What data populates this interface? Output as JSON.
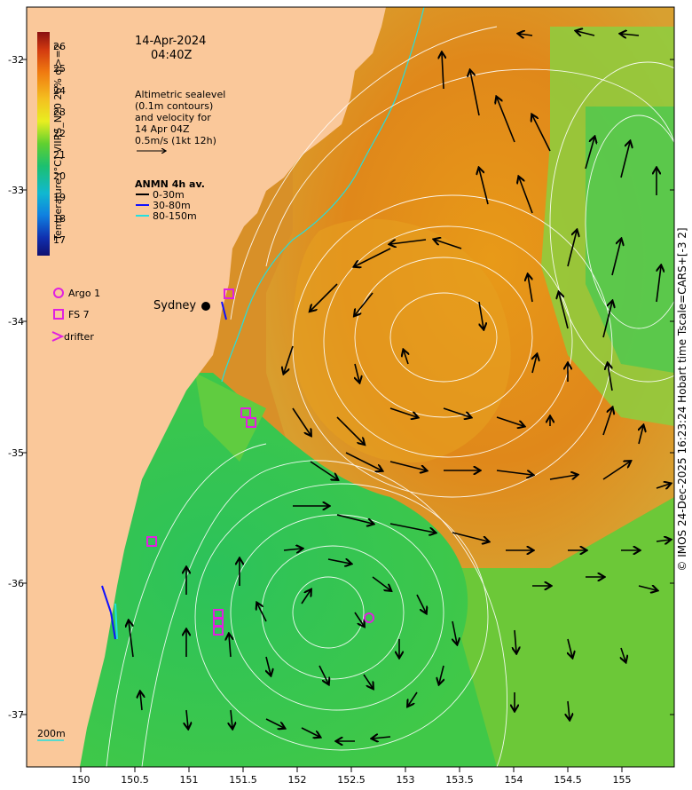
{
  "header": {
    "date": "14-Apr-2024",
    "time": "04:40Z"
  },
  "description": {
    "line1": "Altimetric sealevel",
    "line2": "(0.1m contours)",
    "line3": "and velocity for",
    "line4": "14 Apr 04Z",
    "line5": "0.5m/s (1kt 12h)"
  },
  "anmn": {
    "title": "ANMN 4h av.",
    "items": [
      {
        "label": "0-30m",
        "color": "#000000"
      },
      {
        "label": "30-80m",
        "color": "#1010ff"
      },
      {
        "label": "80-150m",
        "color": "#22e0e0"
      }
    ]
  },
  "colorbar": {
    "label": "Temperature (°C) VIIRS_N20 26% ql>=2",
    "ticks": [
      "26",
      "25",
      "24",
      "23",
      "22",
      "21",
      "20",
      "19",
      "18",
      "17"
    ]
  },
  "legend": {
    "argo": "Argo 1",
    "fs": "FS 7",
    "drifter": "drifter"
  },
  "city": "Sydney",
  "isobath": "200m",
  "credit": "© IMOS 24-Dec-2025 16:23:24 Hobart time Tscale=CARS+[-3 2]",
  "axes": {
    "x_ticks": [
      "150",
      "150.5",
      "151",
      "151.5",
      "152",
      "152.5",
      "153",
      "153.5",
      "154",
      "154.5",
      "155"
    ],
    "y_ticks": [
      "-32",
      "-33",
      "-34",
      "-35",
      "-36",
      "-37"
    ]
  },
  "colors": {
    "land": "#fac89a",
    "warm": "#e08a10",
    "cool": "#2ec850",
    "marker": "#e020e0"
  }
}
